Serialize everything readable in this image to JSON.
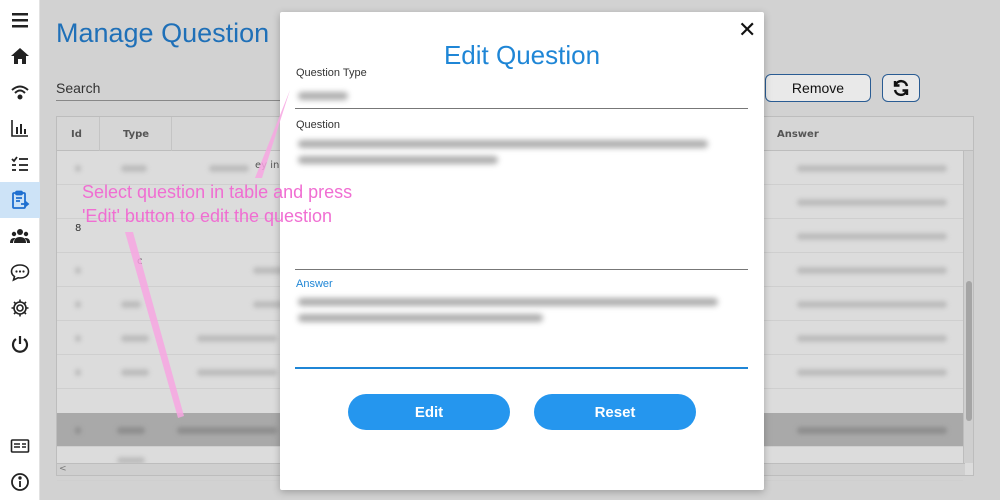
{
  "sidebar": {
    "items": [
      {
        "icon": "menu-icon"
      },
      {
        "icon": "home-icon"
      },
      {
        "icon": "wifi-icon"
      },
      {
        "icon": "bar-chart-icon"
      },
      {
        "icon": "checklist-icon"
      },
      {
        "icon": "clipboard-icon",
        "active": true
      },
      {
        "icon": "users-icon"
      },
      {
        "icon": "chat-icon"
      },
      {
        "icon": "gear-icon"
      },
      {
        "icon": "power-icon"
      },
      {
        "icon": "card-icon"
      },
      {
        "icon": "info-icon"
      }
    ]
  },
  "page": {
    "title": "Manage Question",
    "search_label": "Search",
    "remove_label": "Remove",
    "refresh_icon": "refresh-icon"
  },
  "table": {
    "headers": {
      "id": "Id",
      "type": "Type",
      "answer": "Answer"
    },
    "partial_cells": {
      "row1_question": "ey in",
      "row3_id": "8",
      "row4_type": "c"
    },
    "hscroll_left": "<"
  },
  "callout": {
    "text": "Select question in table and press\n'Edit' button to edit the question"
  },
  "modal": {
    "title": "Edit Question",
    "close_label": "✕",
    "question_type_label": "Question Type",
    "question_label": "Question",
    "answer_label": "Answer",
    "edit_label": "Edit",
    "reset_label": "Reset"
  },
  "colors": {
    "accent": "#1f86d6",
    "button": "#2596ee",
    "callout": "#f06ed2",
    "title": "#1f70b8"
  }
}
